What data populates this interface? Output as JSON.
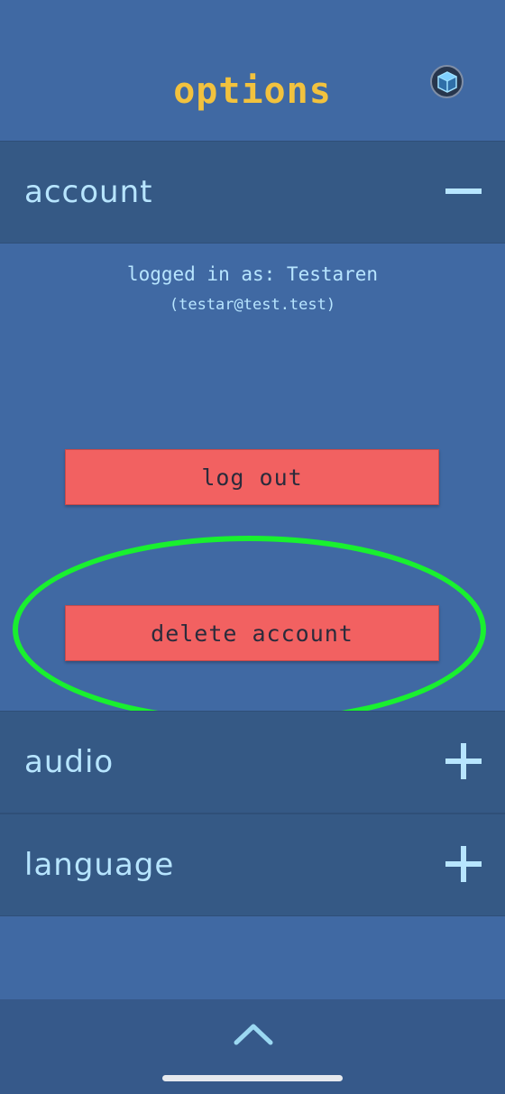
{
  "header": {
    "title": "options"
  },
  "sections": [
    {
      "label": "account",
      "state": "expanded"
    },
    {
      "label": "audio",
      "state": "collapsed"
    },
    {
      "label": "language",
      "state": "collapsed"
    }
  ],
  "account": {
    "logged_in_label": "logged in as:  Testaren",
    "email": "(testar@test.test)",
    "logout_label": "log out",
    "delete_label": "delete account"
  },
  "colors": {
    "background": "#4069a3",
    "section_header": "#355985",
    "title": "#f2c23e",
    "text": "#b7e5ff",
    "danger_button": "#f26161",
    "highlight_ring": "#19f02f"
  },
  "icons": {
    "header_right": "cube-icon",
    "expanded": "minus-icon",
    "collapsed": "plus-icon",
    "bottom": "chevron-up-icon"
  }
}
